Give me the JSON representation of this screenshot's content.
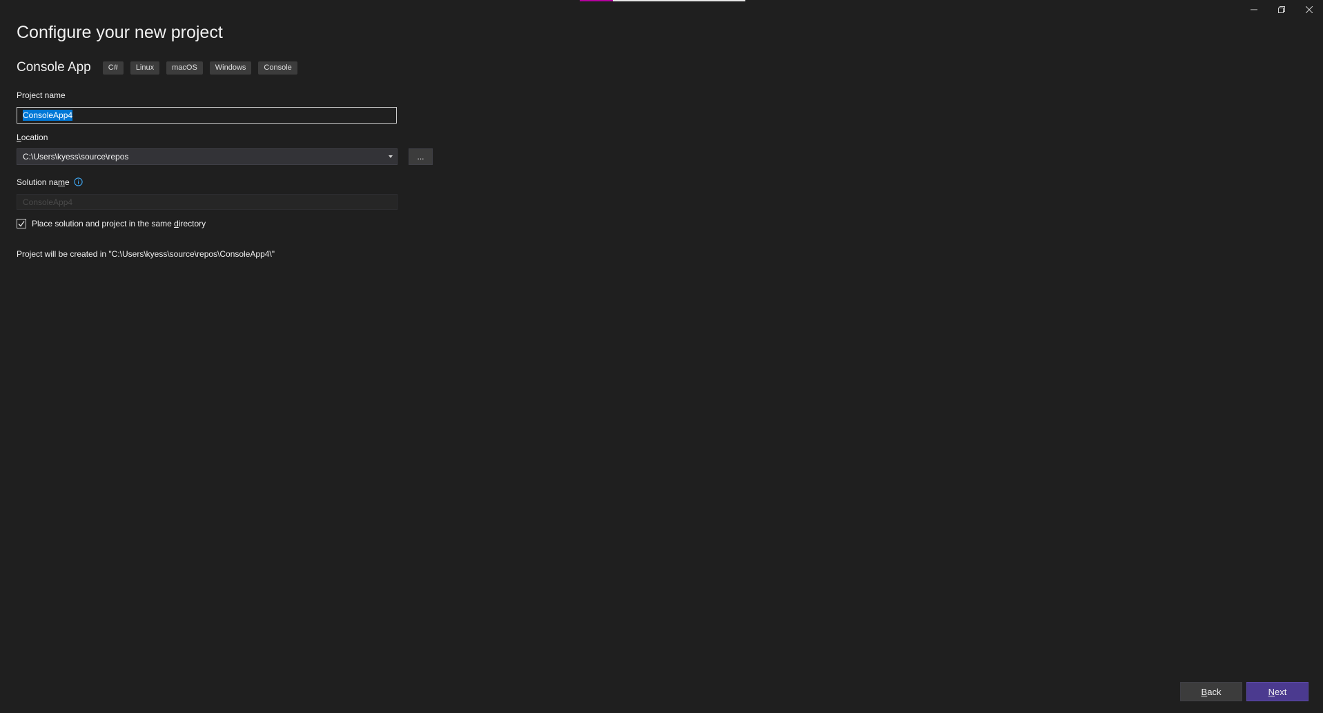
{
  "window": {
    "accent_colors": {
      "primary": "#b4009e",
      "secondary": "#e6e6e6"
    },
    "controls": [
      {
        "name": "minimize",
        "icon": "minimize-icon"
      },
      {
        "name": "restore",
        "icon": "restore-icon"
      },
      {
        "name": "close",
        "icon": "close-icon"
      }
    ]
  },
  "header": {
    "title": "Configure your new project",
    "template_name": "Console App",
    "tags": [
      "C#",
      "Linux",
      "macOS",
      "Windows",
      "Console"
    ]
  },
  "form": {
    "project_name": {
      "label": "Project name",
      "value": "ConsoleApp4"
    },
    "location": {
      "label_prefix": "",
      "label_accel": "L",
      "label_rest": "ocation",
      "value": "C:\\Users\\kyess\\source\\repos",
      "browse_label": "..."
    },
    "solution_name": {
      "label_prefix": "Solution na",
      "label_accel": "m",
      "label_rest": "e",
      "info_icon": "info-icon",
      "placeholder": "ConsoleApp4"
    },
    "same_directory": {
      "checked": true,
      "label_prefix": "Place solution and project in the same ",
      "label_accel": "d",
      "label_rest": "irectory"
    },
    "summary": "Project will be created in \"C:\\Users\\kyess\\source\\repos\\ConsoleApp4\\\""
  },
  "footer": {
    "back": {
      "accel": "B",
      "rest": "ack"
    },
    "next": {
      "accel": "N",
      "rest": "ext"
    },
    "accent": "#4b3a8f"
  }
}
